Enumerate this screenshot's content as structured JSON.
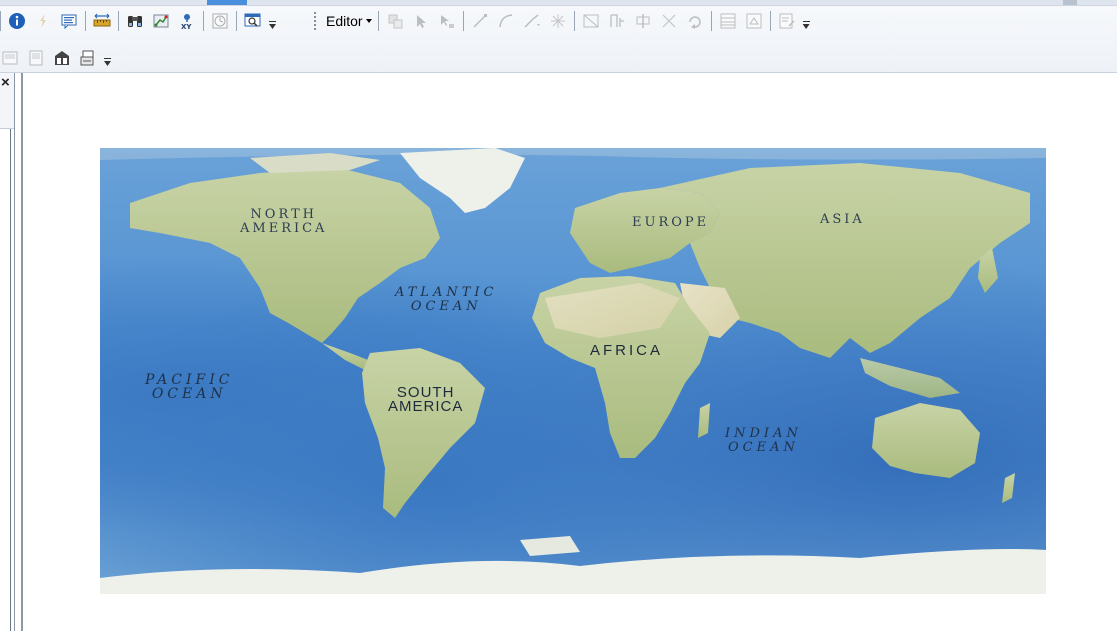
{
  "toolbar": {
    "editor_label": "Editor",
    "row1_left_icons": [
      "identify-icon",
      "hyperlink-icon",
      "html-popup-icon",
      "measure-icon",
      "find-icon",
      "find-route-icon",
      "go-to-xy-icon",
      "time-slider-icon",
      "create-viewer-window-icon"
    ],
    "editor_icons": [
      "edit-tool-icon",
      "edit-annotation-icon",
      "edit-vertices-icon",
      "straight-segment-icon",
      "endpoint-arc-icon",
      "trace-icon",
      "point-icon",
      "topology-edit-icon",
      "reshape-icon",
      "cut-polygons-icon",
      "split-icon",
      "rotate-icon",
      "attributes-icon",
      "sketch-properties-icon",
      "create-features-icon"
    ],
    "row2_icons": [
      "layout-page-icon",
      "data-view-icon",
      "toggle-draft-icon",
      "refresh-icon"
    ]
  },
  "left_panel": {
    "close_label": "×"
  },
  "map": {
    "labels": {
      "north_america": "NORTH\nAMERICA",
      "europe": "EUROPE",
      "asia": "ASIA",
      "atlantic_ocean": "ATLANTIC\nOCEAN",
      "africa": "AFRICA",
      "pacific_ocean": "PACIFIC\nOCEAN",
      "south_america": "SOUTH\nAMERICA",
      "indian_ocean": "INDIAN\nOCEAN"
    },
    "colors": {
      "ocean": "#4f8ed0",
      "land": "#b7c58e",
      "ice": "#eef0ea"
    }
  }
}
